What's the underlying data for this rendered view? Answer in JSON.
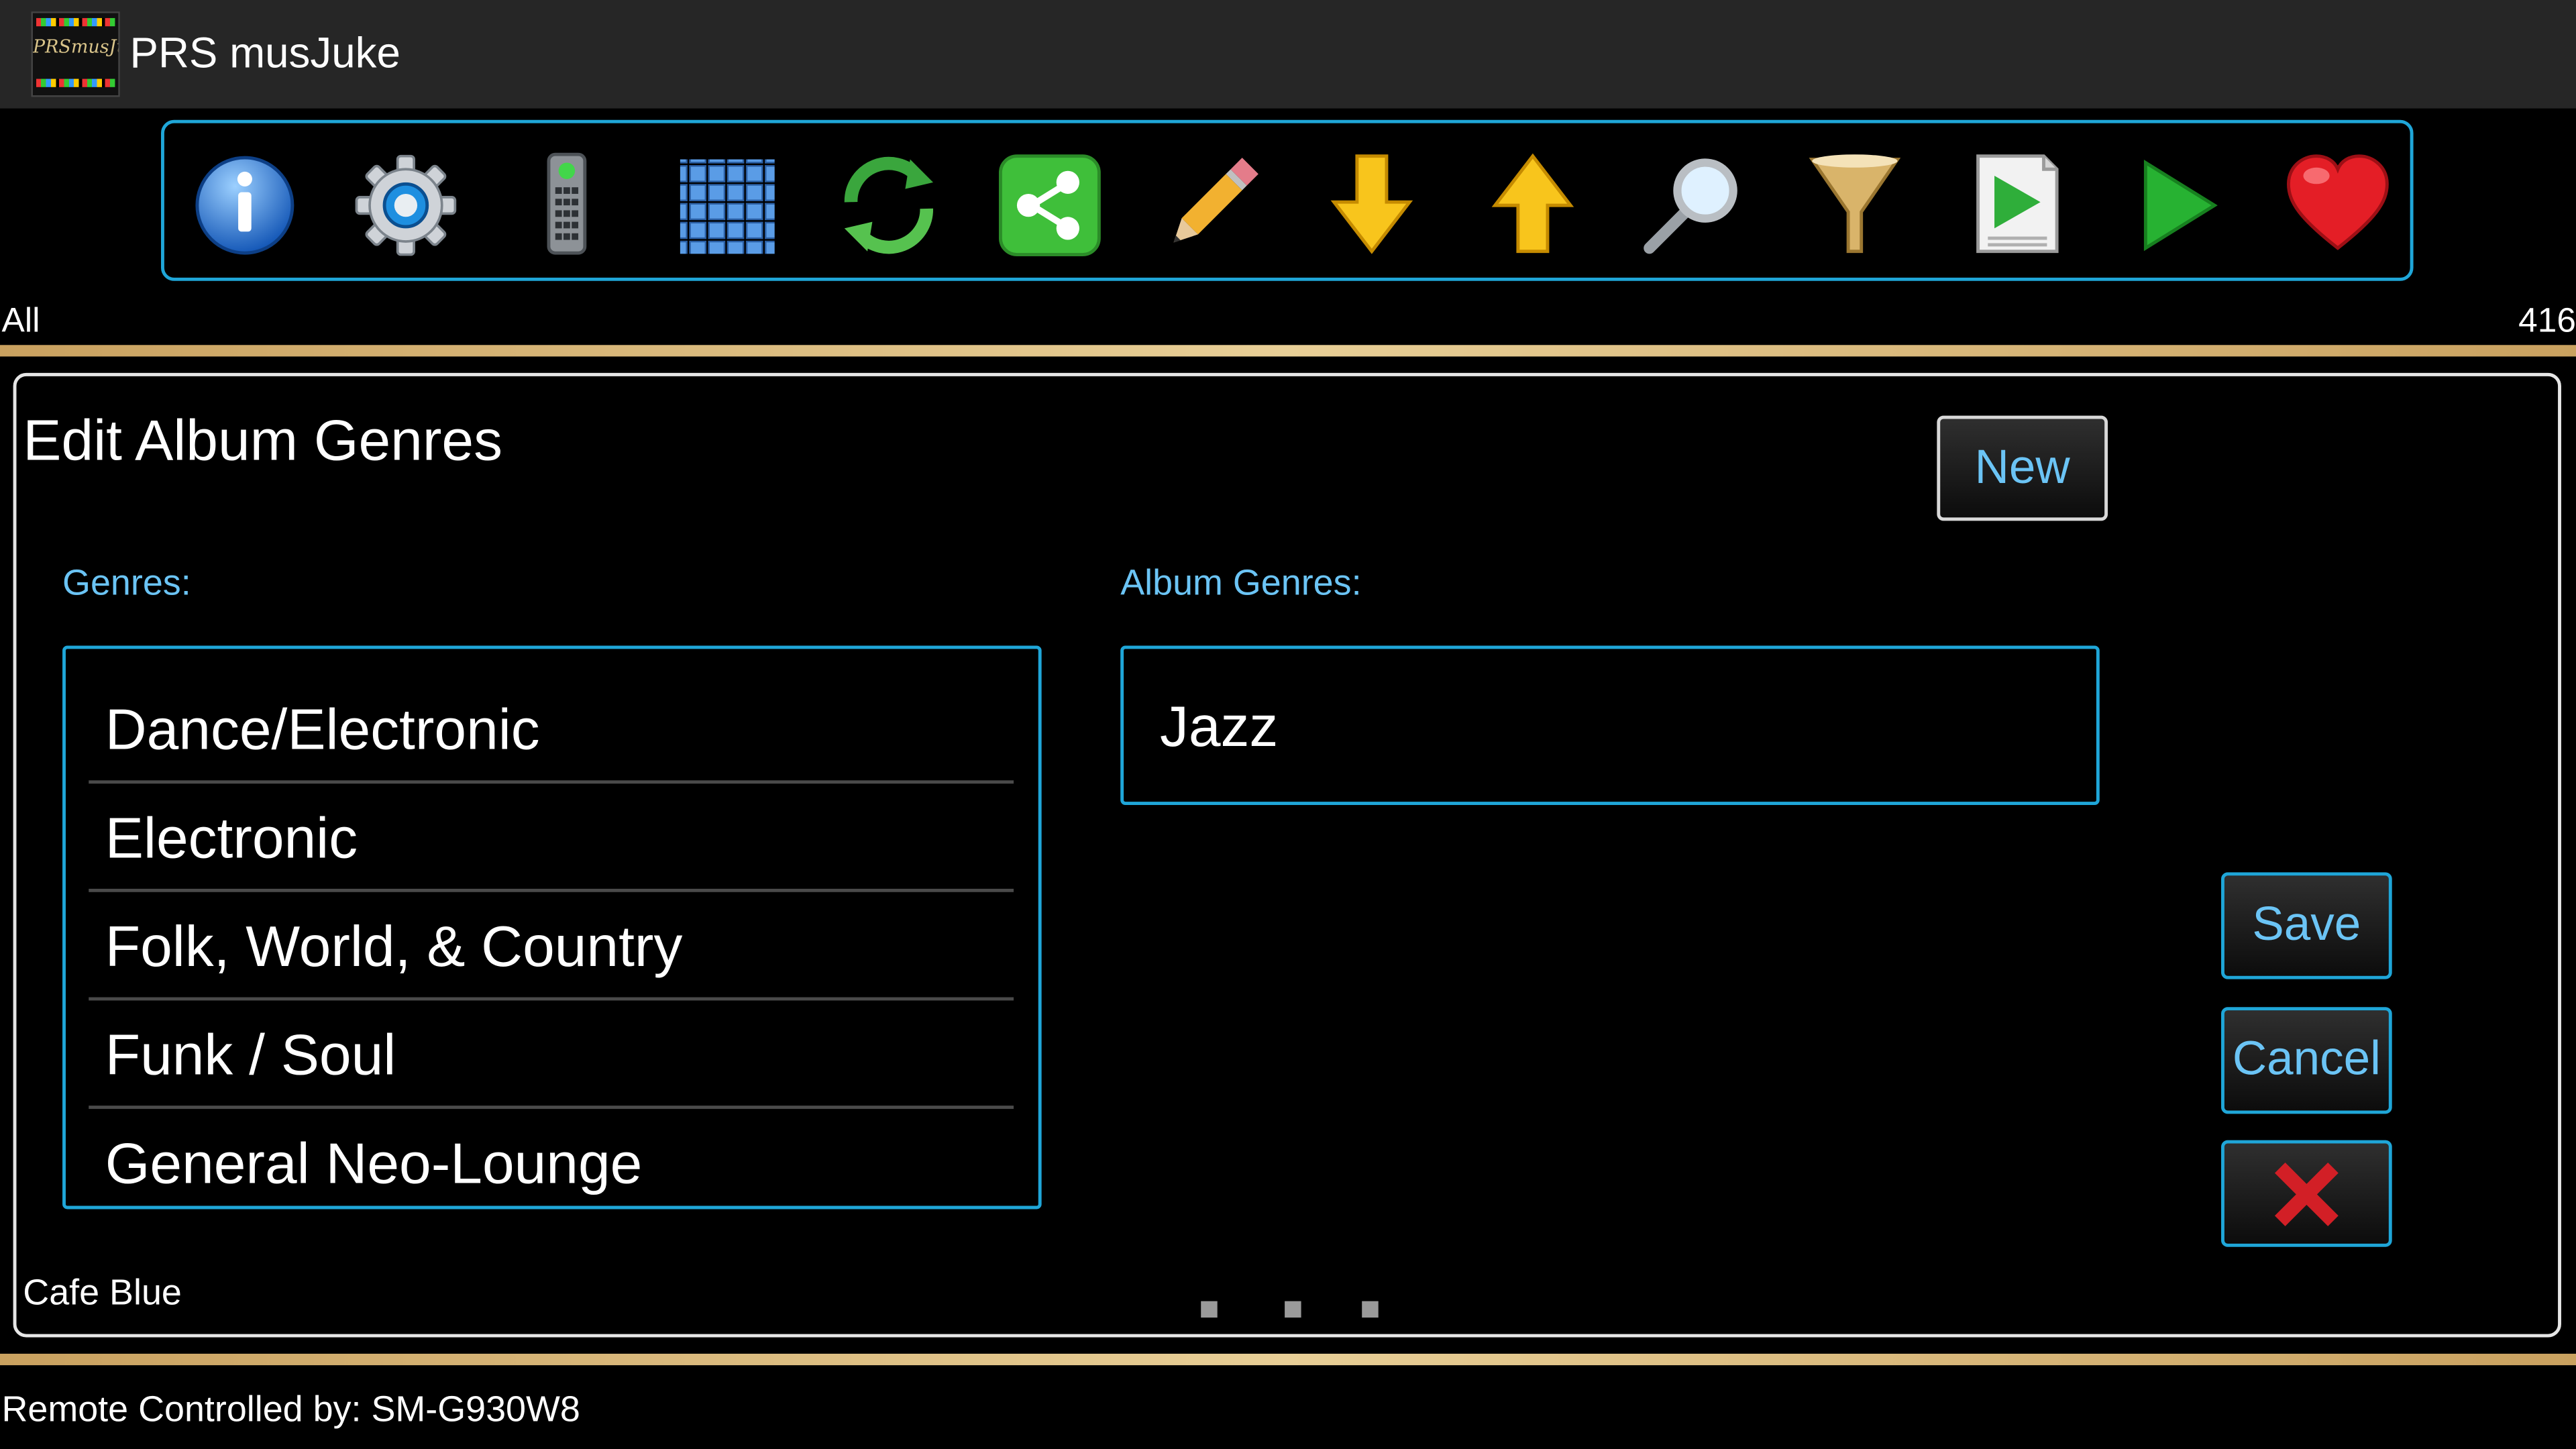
{
  "app": {
    "title": "PRS musJuke",
    "logo_text": "PRSmusJuke"
  },
  "toolbar": {
    "buttons": [
      {
        "icon": "info-icon"
      },
      {
        "icon": "settings-gear-icon"
      },
      {
        "icon": "remote-control-icon"
      },
      {
        "icon": "grid-view-icon"
      },
      {
        "icon": "refresh-icon"
      },
      {
        "icon": "share-icon"
      },
      {
        "icon": "edit-pencil-icon"
      },
      {
        "icon": "arrow-down-icon"
      },
      {
        "icon": "arrow-up-icon"
      },
      {
        "icon": "search-icon"
      },
      {
        "icon": "filter-funnel-icon"
      },
      {
        "icon": "playlist-icon"
      },
      {
        "icon": "play-icon"
      },
      {
        "icon": "favorite-heart-icon"
      }
    ]
  },
  "filter": {
    "label": "All",
    "count": "416"
  },
  "dialog": {
    "title": "Edit Album Genres",
    "new_label": "New",
    "genres_label": "Genres:",
    "album_genres_label": "Album Genres:",
    "genres": [
      "Dance/Electronic",
      "Electronic",
      "Folk, World, & Country",
      "Funk / Soul",
      "General Neo-Lounge"
    ],
    "album_genres": [
      "Jazz"
    ],
    "save_label": "Save",
    "cancel_label": "Cancel",
    "close_icon": "close-x-icon",
    "current_album": "Cafe Blue"
  },
  "status": {
    "text": "Remote Controlled by: SM-G930W8"
  },
  "colors": {
    "accent": "#1fa6d8",
    "label": "#6bc4f5",
    "gold": "#d8b97a",
    "titlebar": "#262626"
  }
}
